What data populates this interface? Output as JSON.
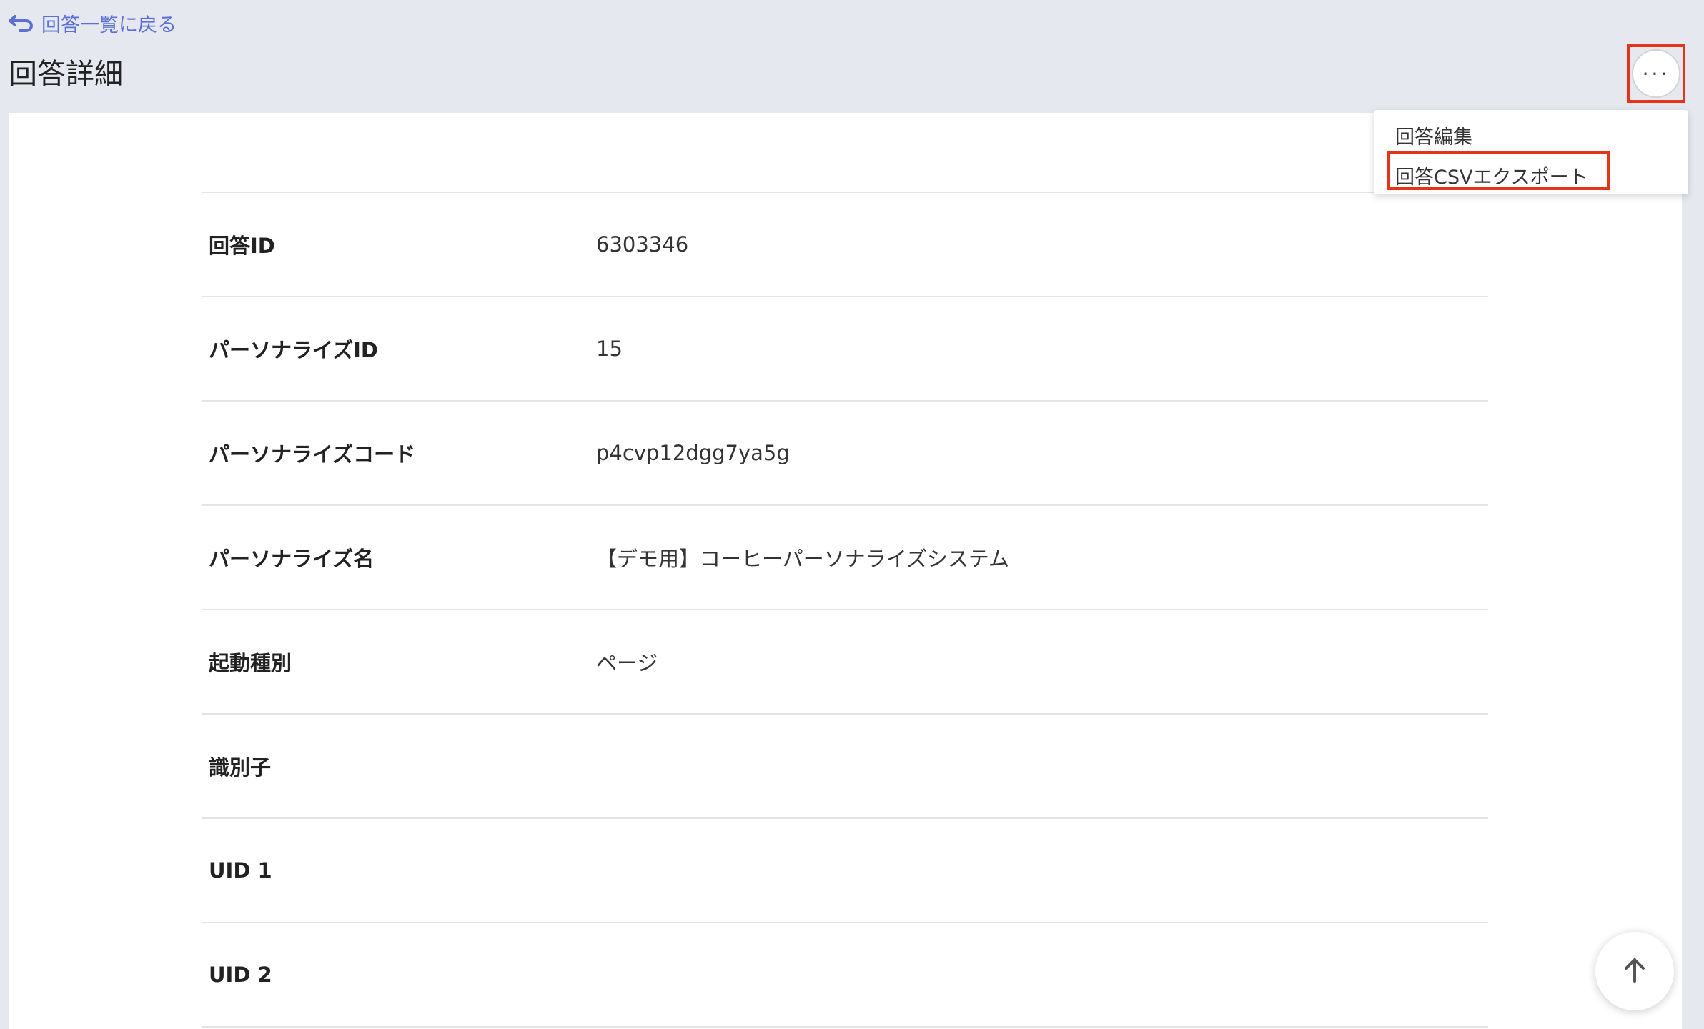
{
  "header": {
    "back_label": "回答一覧に戻る",
    "page_title": "回答詳細"
  },
  "menu": {
    "button_label": "···",
    "items": [
      {
        "label": "回答編集"
      },
      {
        "label": "回答CSVエクスポート"
      }
    ]
  },
  "details": [
    {
      "label": "回答ID",
      "value": "6303346"
    },
    {
      "label": "パーソナライズID",
      "value": "15"
    },
    {
      "label": "パーソナライズコード",
      "value": "p4cvp12dgg7ya5g"
    },
    {
      "label": "パーソナライズ名",
      "value": "【デモ用】コーヒーパーソナライズシステム"
    },
    {
      "label": "起動種別",
      "value": "ページ"
    },
    {
      "label": "識別子",
      "value": ""
    },
    {
      "label": "UID 1",
      "value": ""
    },
    {
      "label": "UID 2",
      "value": ""
    }
  ],
  "colors": {
    "accent": "#5b6fd6",
    "highlight": "#e53417",
    "background": "#e6e8f0"
  },
  "icons": {
    "back": "undo-arrow-icon",
    "menu": "more-horizontal-icon",
    "scroll_top": "arrow-up-icon"
  }
}
